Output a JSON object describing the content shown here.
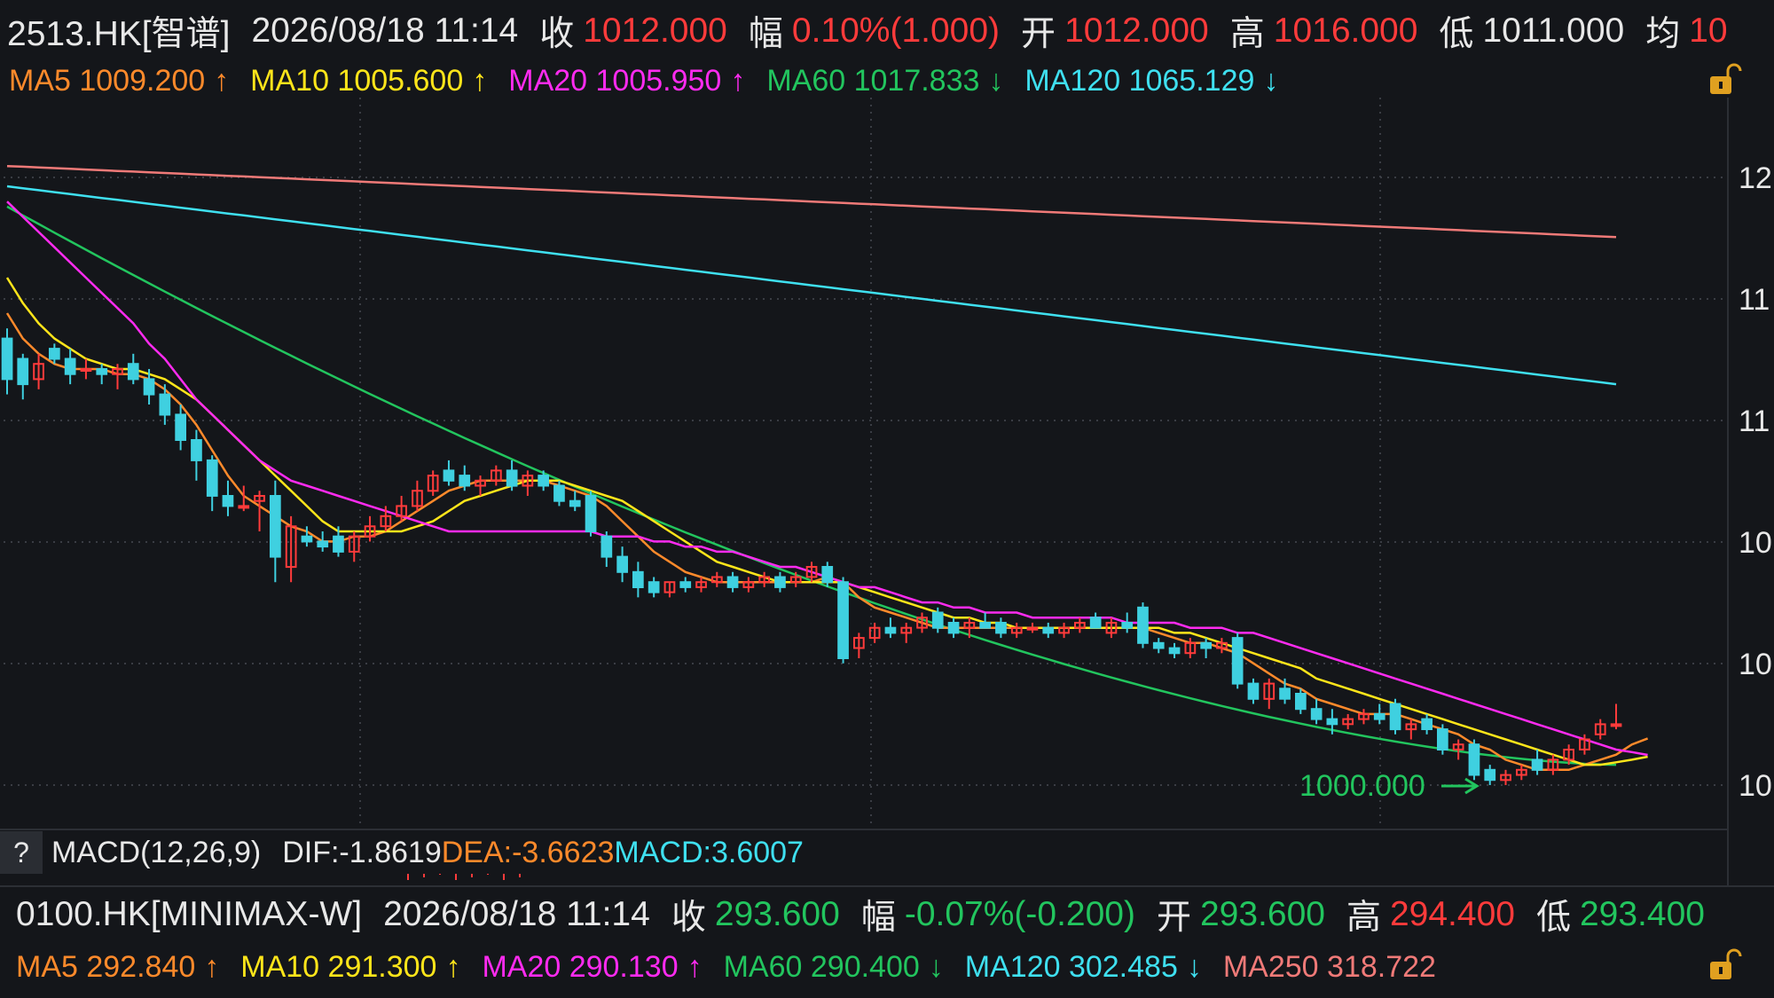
{
  "top_quote": {
    "symbol": "2513.HK[智谱]",
    "datetime": "2026/08/18 11:14",
    "close_label": "收",
    "close": "1012.000",
    "change_label": "幅",
    "change": "0.10%(1.000)",
    "open_label": "开",
    "open": "1012.000",
    "high_label": "高",
    "high": "1016.000",
    "low_label": "低",
    "low": "1011.000",
    "avg_label": "均",
    "avg": "10"
  },
  "top_ma": {
    "ma5": "MA5 1009.200",
    "ma5_arrow": "↑",
    "ma10": "MA10 1005.600",
    "ma10_arrow": "↑",
    "ma20": "MA20 1005.950",
    "ma20_arrow": "↑",
    "ma60": "MA60 1017.833",
    "ma60_arrow": "↓",
    "ma120": "MA120 1065.129",
    "ma120_arrow": "↓"
  },
  "price_axis_labels": [
    "12",
    "11",
    "11",
    "10",
    "10",
    "10"
  ],
  "low_marker": "1000.000",
  "macd": {
    "help": "?",
    "name": "MACD(12,26,9)",
    "dif": "DIF:-1.8619",
    "dea": "DEA:-3.6623",
    "macd": "MACD:3.6007"
  },
  "bottom_quote": {
    "symbol": "0100.HK[MINIMAX-W]",
    "datetime": "2026/08/18 11:14",
    "close_label": "收",
    "close": "293.600",
    "change_label": "幅",
    "change": "-0.07%(-0.200)",
    "open_label": "开",
    "open": "293.600",
    "high_label": "高",
    "high": "294.400",
    "low_label": "低",
    "low": "293.400"
  },
  "bottom_ma": {
    "ma5": "MA5 292.840",
    "ma5_arrow": "↑",
    "ma10": "MA10 291.300",
    "ma10_arrow": "↑",
    "ma20": "MA20 290.130",
    "ma20_arrow": "↑",
    "ma60": "MA60 290.400",
    "ma60_arrow": "↓",
    "ma120": "MA120 302.485",
    "ma120_arrow": "↓",
    "ma250": "MA250 318.722"
  },
  "colors": {
    "background": "#14161a",
    "grid": "#3a3d44",
    "up": "#ff3b3b",
    "down": "#3fd0e0",
    "ma5": "#ff8a2b",
    "ma10": "#ffe51a",
    "ma20": "#ff2bf0",
    "ma60": "#22c55e",
    "ma120": "#3fe0f0",
    "ma250": "#f07a78"
  },
  "chart_data": {
    "type": "candlestick",
    "title": "",
    "xlabel": "",
    "ylabel": "",
    "ylim": [
      1000,
      1125
    ],
    "grid": true,
    "candles": [
      {
        "o": 1088,
        "h": 1090,
        "l": 1077,
        "c": 1080
      },
      {
        "o": 1084,
        "h": 1085,
        "l": 1076,
        "c": 1079
      },
      {
        "o": 1080,
        "h": 1085,
        "l": 1078,
        "c": 1083
      },
      {
        "o": 1086,
        "h": 1087,
        "l": 1083,
        "c": 1084
      },
      {
        "o": 1084,
        "h": 1086,
        "l": 1079,
        "c": 1081
      },
      {
        "o": 1082,
        "h": 1084,
        "l": 1080,
        "c": 1082
      },
      {
        "o": 1082,
        "h": 1083,
        "l": 1079,
        "c": 1081
      },
      {
        "o": 1081,
        "h": 1083,
        "l": 1078,
        "c": 1082
      },
      {
        "o": 1083,
        "h": 1085,
        "l": 1079,
        "c": 1080
      },
      {
        "o": 1080,
        "h": 1082,
        "l": 1075,
        "c": 1077
      },
      {
        "o": 1077,
        "h": 1079,
        "l": 1071,
        "c": 1073
      },
      {
        "o": 1073,
        "h": 1075,
        "l": 1066,
        "c": 1068
      },
      {
        "o": 1068,
        "h": 1070,
        "l": 1060,
        "c": 1064
      },
      {
        "o": 1064,
        "h": 1065,
        "l": 1054,
        "c": 1057
      },
      {
        "o": 1057,
        "h": 1060,
        "l": 1053,
        "c": 1055
      },
      {
        "o": 1055,
        "h": 1059,
        "l": 1054,
        "c": 1055
      },
      {
        "o": 1056,
        "h": 1058,
        "l": 1050,
        "c": 1057
      },
      {
        "o": 1057,
        "h": 1060,
        "l": 1040,
        "c": 1045
      },
      {
        "o": 1043,
        "h": 1053,
        "l": 1040,
        "c": 1051
      },
      {
        "o": 1049,
        "h": 1051,
        "l": 1047,
        "c": 1048
      },
      {
        "o": 1048,
        "h": 1050,
        "l": 1046,
        "c": 1047
      },
      {
        "o": 1049,
        "h": 1051,
        "l": 1045,
        "c": 1046
      },
      {
        "o": 1046,
        "h": 1050,
        "l": 1044,
        "c": 1049
      },
      {
        "o": 1049,
        "h": 1053,
        "l": 1048,
        "c": 1051
      },
      {
        "o": 1051,
        "h": 1055,
        "l": 1050,
        "c": 1053
      },
      {
        "o": 1053,
        "h": 1057,
        "l": 1052,
        "c": 1055
      },
      {
        "o": 1055,
        "h": 1060,
        "l": 1054,
        "c": 1058
      },
      {
        "o": 1058,
        "h": 1062,
        "l": 1057,
        "c": 1061
      },
      {
        "o": 1062,
        "h": 1064,
        "l": 1059,
        "c": 1060
      },
      {
        "o": 1061,
        "h": 1063,
        "l": 1058,
        "c": 1059
      },
      {
        "o": 1059,
        "h": 1061,
        "l": 1057,
        "c": 1060
      },
      {
        "o": 1060,
        "h": 1063,
        "l": 1059,
        "c": 1062
      },
      {
        "o": 1062,
        "h": 1064,
        "l": 1058,
        "c": 1059
      },
      {
        "o": 1059,
        "h": 1062,
        "l": 1057,
        "c": 1061
      },
      {
        "o": 1061,
        "h": 1062,
        "l": 1058,
        "c": 1059
      },
      {
        "o": 1059,
        "h": 1060,
        "l": 1055,
        "c": 1056
      },
      {
        "o": 1056,
        "h": 1058,
        "l": 1054,
        "c": 1055
      },
      {
        "o": 1057,
        "h": 1058,
        "l": 1049,
        "c": 1050
      },
      {
        "o": 1049,
        "h": 1050,
        "l": 1043,
        "c": 1045
      },
      {
        "o": 1045,
        "h": 1047,
        "l": 1040,
        "c": 1042
      },
      {
        "o": 1042,
        "h": 1044,
        "l": 1037,
        "c": 1039
      },
      {
        "o": 1040,
        "h": 1041,
        "l": 1037,
        "c": 1038
      },
      {
        "o": 1038,
        "h": 1040,
        "l": 1037,
        "c": 1040
      },
      {
        "o": 1040,
        "h": 1041,
        "l": 1038,
        "c": 1039
      },
      {
        "o": 1039,
        "h": 1041,
        "l": 1038,
        "c": 1040
      },
      {
        "o": 1040,
        "h": 1042,
        "l": 1039,
        "c": 1041
      },
      {
        "o": 1041,
        "h": 1042,
        "l": 1038,
        "c": 1039
      },
      {
        "o": 1039,
        "h": 1041,
        "l": 1038,
        "c": 1040
      },
      {
        "o": 1040,
        "h": 1042,
        "l": 1039,
        "c": 1041
      },
      {
        "o": 1041,
        "h": 1042,
        "l": 1038,
        "c": 1039
      },
      {
        "o": 1040,
        "h": 1042,
        "l": 1039,
        "c": 1041
      },
      {
        "o": 1041,
        "h": 1044,
        "l": 1040,
        "c": 1043
      },
      {
        "o": 1043,
        "h": 1044,
        "l": 1039,
        "c": 1040
      },
      {
        "o": 1040,
        "h": 1041,
        "l": 1024,
        "c": 1025
      },
      {
        "o": 1027,
        "h": 1030,
        "l": 1025,
        "c": 1029
      },
      {
        "o": 1029,
        "h": 1032,
        "l": 1028,
        "c": 1031
      },
      {
        "o": 1031,
        "h": 1033,
        "l": 1029,
        "c": 1030
      },
      {
        "o": 1030,
        "h": 1032,
        "l": 1028,
        "c": 1031
      },
      {
        "o": 1031,
        "h": 1034,
        "l": 1030,
        "c": 1033
      },
      {
        "o": 1034,
        "h": 1035,
        "l": 1030,
        "c": 1031
      },
      {
        "o": 1032,
        "h": 1033,
        "l": 1029,
        "c": 1030
      },
      {
        "o": 1031,
        "h": 1033,
        "l": 1029,
        "c": 1032
      },
      {
        "o": 1032,
        "h": 1034,
        "l": 1031,
        "c": 1031
      },
      {
        "o": 1032,
        "h": 1033,
        "l": 1029,
        "c": 1030
      },
      {
        "o": 1030,
        "h": 1032,
        "l": 1029,
        "c": 1031
      },
      {
        "o": 1031,
        "h": 1032,
        "l": 1030,
        "c": 1031
      },
      {
        "o": 1031,
        "h": 1032,
        "l": 1029,
        "c": 1030
      },
      {
        "o": 1030,
        "h": 1032,
        "l": 1029,
        "c": 1031
      },
      {
        "o": 1031,
        "h": 1033,
        "l": 1030,
        "c": 1032
      },
      {
        "o": 1033,
        "h": 1034,
        "l": 1031,
        "c": 1031
      },
      {
        "o": 1030,
        "h": 1033,
        "l": 1029,
        "c": 1032
      },
      {
        "o": 1032,
        "h": 1034,
        "l": 1030,
        "c": 1031
      },
      {
        "o": 1035,
        "h": 1036,
        "l": 1027,
        "c": 1028
      },
      {
        "o": 1028,
        "h": 1029,
        "l": 1026,
        "c": 1027
      },
      {
        "o": 1027,
        "h": 1028,
        "l": 1025,
        "c": 1026
      },
      {
        "o": 1026,
        "h": 1029,
        "l": 1025,
        "c": 1028
      },
      {
        "o": 1028,
        "h": 1029,
        "l": 1025,
        "c": 1027
      },
      {
        "o": 1027,
        "h": 1029,
        "l": 1026,
        "c": 1028
      },
      {
        "o": 1029,
        "h": 1030,
        "l": 1019,
        "c": 1020
      },
      {
        "o": 1020,
        "h": 1021,
        "l": 1016,
        "c": 1017
      },
      {
        "o": 1017,
        "h": 1021,
        "l": 1015,
        "c": 1020
      },
      {
        "o": 1019,
        "h": 1021,
        "l": 1016,
        "c": 1017
      },
      {
        "o": 1018,
        "h": 1019,
        "l": 1014,
        "c": 1015
      },
      {
        "o": 1015,
        "h": 1017,
        "l": 1012,
        "c": 1013
      },
      {
        "o": 1013,
        "h": 1015,
        "l": 1010,
        "c": 1012
      },
      {
        "o": 1012,
        "h": 1014,
        "l": 1011,
        "c": 1013
      },
      {
        "o": 1013,
        "h": 1015,
        "l": 1012,
        "c": 1014
      },
      {
        "o": 1014,
        "h": 1016,
        "l": 1012,
        "c": 1013
      },
      {
        "o": 1016,
        "h": 1017,
        "l": 1010,
        "c": 1011
      },
      {
        "o": 1011,
        "h": 1013,
        "l": 1009,
        "c": 1012
      },
      {
        "o": 1013,
        "h": 1014,
        "l": 1010,
        "c": 1011
      },
      {
        "o": 1011,
        "h": 1012,
        "l": 1006,
        "c": 1007
      },
      {
        "o": 1007,
        "h": 1009,
        "l": 1005,
        "c": 1008
      },
      {
        "o": 1008,
        "h": 1009,
        "l": 1001,
        "c": 1002
      },
      {
        "o": 1003,
        "h": 1004,
        "l": 1000,
        "c": 1001
      },
      {
        "o": 1001,
        "h": 1003,
        "l": 1000,
        "c": 1002
      },
      {
        "o": 1002,
        "h": 1004,
        "l": 1001,
        "c": 1003
      },
      {
        "o": 1005,
        "h": 1007,
        "l": 1002,
        "c": 1003
      },
      {
        "o": 1003,
        "h": 1006,
        "l": 1002,
        "c": 1005
      },
      {
        "o": 1005,
        "h": 1008,
        "l": 1004,
        "c": 1007
      },
      {
        "o": 1007,
        "h": 1010,
        "l": 1006,
        "c": 1009
      },
      {
        "o": 1010,
        "h": 1013,
        "l": 1009,
        "c": 1012
      },
      {
        "o": 1012,
        "h": 1016,
        "l": 1011,
        "c": 1012
      }
    ],
    "series": [
      {
        "name": "MA5",
        "color": "#ff8a2b",
        "values": [
          1093,
          1088,
          1085,
          1083,
          1082,
          1082,
          1082,
          1081,
          1081,
          1080,
          1078,
          1075,
          1071,
          1066,
          1061,
          1057,
          1055,
          1053,
          1051,
          1050,
          1048,
          1048,
          1049,
          1049,
          1050,
          1052,
          1054,
          1056,
          1058,
          1059,
          1060,
          1060,
          1060,
          1060,
          1060,
          1059,
          1058,
          1057,
          1055,
          1052,
          1049,
          1046,
          1044,
          1042,
          1041,
          1040,
          1040,
          1040,
          1040,
          1040,
          1040,
          1040,
          1041,
          1040,
          1037,
          1035,
          1034,
          1033,
          1032,
          1031,
          1031,
          1031,
          1031,
          1031,
          1031,
          1031,
          1031,
          1031,
          1031,
          1031,
          1031,
          1031,
          1031,
          1030,
          1029,
          1028,
          1028,
          1027,
          1026,
          1024,
          1022,
          1020,
          1019,
          1017,
          1016,
          1015,
          1014,
          1014,
          1014,
          1013,
          1012,
          1011,
          1010,
          1008,
          1007,
          1005,
          1004,
          1003,
          1003,
          1003,
          1004,
          1005,
          1006,
          1008,
          1009.2
        ]
      },
      {
        "name": "MA10",
        "color": "#ffe51a",
        "values": [
          1100,
          1095,
          1091,
          1088,
          1086,
          1084,
          1083,
          1082,
          1082,
          1081,
          1080,
          1078,
          1076,
          1073,
          1070,
          1067,
          1064,
          1061,
          1058,
          1055,
          1052,
          1050,
          1050,
          1050,
          1050,
          1050,
          1051,
          1052,
          1054,
          1056,
          1057,
          1058,
          1059,
          1060,
          1060,
          1060,
          1059,
          1058,
          1057,
          1056,
          1054,
          1052,
          1050,
          1048,
          1046,
          1044,
          1043,
          1042,
          1041,
          1040,
          1040,
          1040,
          1040,
          1040,
          1039,
          1038,
          1037,
          1036,
          1035,
          1034,
          1033,
          1033,
          1032,
          1032,
          1031,
          1031,
          1031,
          1031,
          1031,
          1031,
          1031,
          1031,
          1031,
          1031,
          1030,
          1030,
          1029,
          1028,
          1027,
          1026,
          1025,
          1024,
          1023,
          1021,
          1020,
          1019,
          1018,
          1017,
          1016,
          1015,
          1014,
          1013,
          1012,
          1011,
          1010,
          1009,
          1008,
          1007,
          1006,
          1005,
          1004,
          1004,
          1004.5,
          1005,
          1005.6
        ]
      },
      {
        "name": "MA20",
        "color": "#ff2bf0",
        "values": [
          1115,
          1112,
          1109,
          1106,
          1103,
          1100,
          1097,
          1094,
          1091,
          1087,
          1084,
          1080,
          1076,
          1073,
          1070,
          1067,
          1064,
          1062,
          1060,
          1059,
          1058,
          1057,
          1056,
          1055,
          1054,
          1053,
          1052,
          1051,
          1050,
          1050,
          1050,
          1050,
          1050,
          1050,
          1050,
          1050,
          1050,
          1050,
          1049,
          1049,
          1049,
          1048,
          1048,
          1047,
          1047,
          1046,
          1046,
          1045,
          1044,
          1043,
          1043,
          1042,
          1041,
          1040,
          1039,
          1039,
          1038,
          1037,
          1036,
          1036,
          1035,
          1035,
          1034,
          1034,
          1034,
          1033,
          1033,
          1033,
          1033,
          1033,
          1033,
          1032,
          1032,
          1032,
          1032,
          1031,
          1031,
          1031,
          1030,
          1030,
          1029,
          1028,
          1027,
          1026,
          1025,
          1024,
          1023,
          1022,
          1021,
          1020,
          1019,
          1018,
          1017,
          1016,
          1015,
          1014,
          1013,
          1012,
          1011,
          1010,
          1009,
          1008,
          1007,
          1006.5,
          1005.95
        ]
      },
      {
        "name": "MA60",
        "color": "#22c55e",
        "values": [
          1110,
          1109,
          1108,
          1107,
          1106,
          1105,
          1104,
          1103,
          1102,
          1101,
          1100,
          1099,
          1097,
          1095,
          1093,
          1091,
          1089,
          1087,
          1085,
          1083,
          1081,
          1079,
          1077,
          1075,
          1073,
          1071,
          1069,
          1067,
          1065,
          1063,
          1061,
          1059,
          1057,
          1055,
          1053,
          1051,
          1049,
          1047,
          1045,
          1043,
          1041,
          1039,
          1038,
          1037,
          1036,
          1035,
          1034,
          1033,
          1032,
          1031,
          1030,
          1029,
          1028,
          1027,
          1026,
          1025,
          1024,
          1023,
          1022,
          1021,
          1020,
          1019,
          1018,
          1017,
          1016,
          1015,
          1014,
          1013,
          1012,
          1011,
          1010,
          1009,
          1008,
          1007,
          1006,
          1005,
          1004,
          1003,
          1002,
          1001,
          1000,
          1000,
          1000,
          1000,
          1000,
          1000,
          1000,
          1000,
          1000,
          1000,
          1000,
          1000,
          1000,
          1000,
          1000,
          1000,
          1000,
          1000,
          1000,
          1000,
          1000,
          1000,
          1000,
          1000,
          1017.833
        ]
      },
      {
        "name": "MA120",
        "color": "#3fe0f0",
        "values": []
      },
      {
        "name": "MA250",
        "color": "#f07a78",
        "values": []
      }
    ]
  }
}
